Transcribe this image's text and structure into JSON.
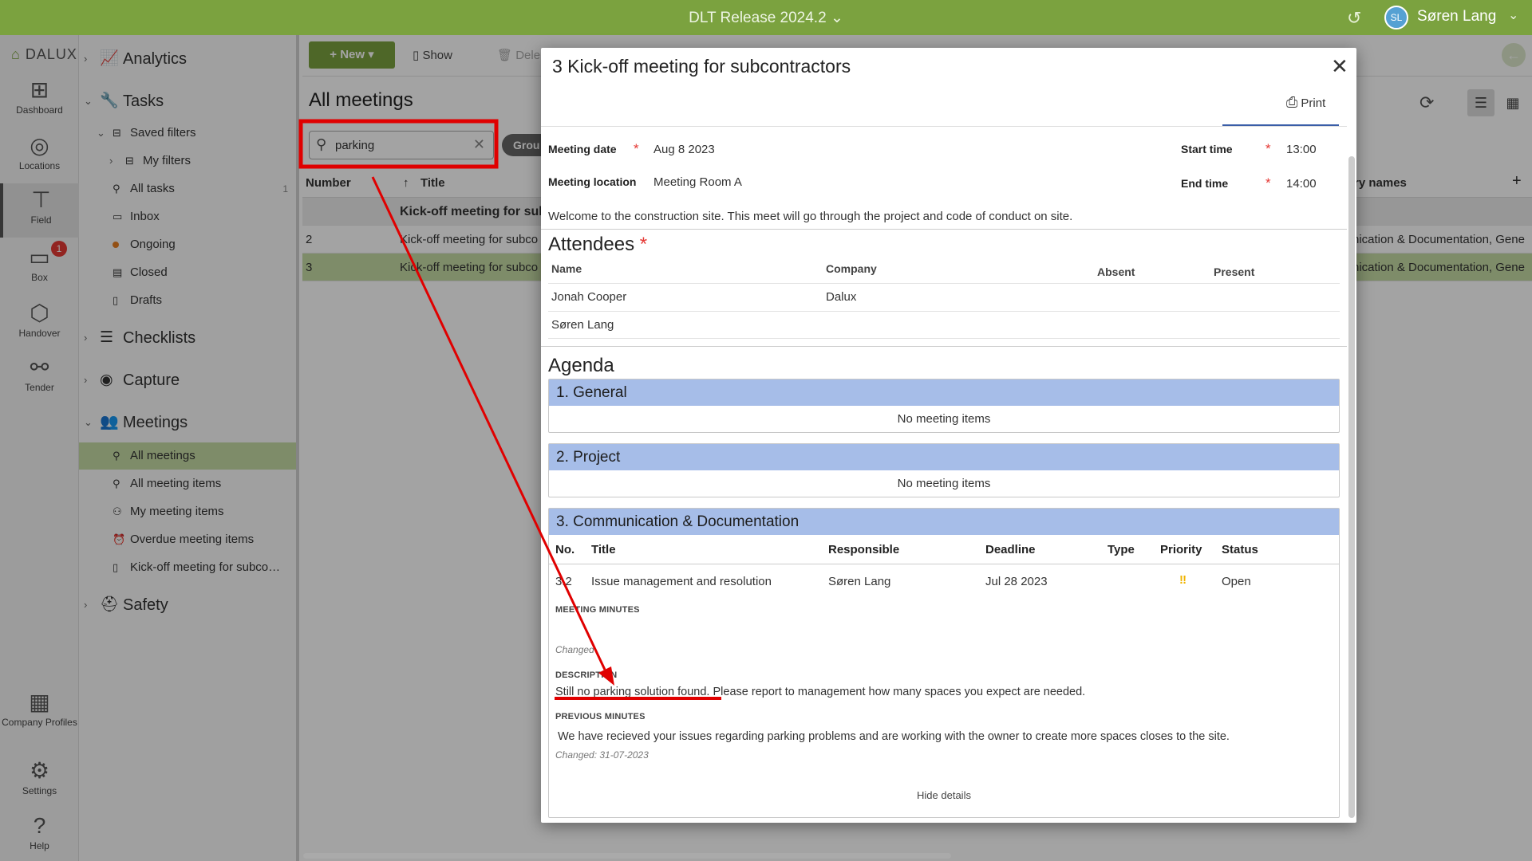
{
  "topbar": {
    "project": "DLT Release 2024.2",
    "user_initials": "SL",
    "user_name": "Søren Lang"
  },
  "rail": {
    "logo": "DALUX",
    "items": [
      {
        "label": "Dashboard",
        "icon": "dashboard-icon"
      },
      {
        "label": "Locations",
        "icon": "location-pin-icon"
      },
      {
        "label": "Field",
        "icon": "crane-icon"
      },
      {
        "label": "Box",
        "icon": "folder-icon",
        "badge": "1"
      },
      {
        "label": "Handover",
        "icon": "box-icon"
      },
      {
        "label": "Tender",
        "icon": "handshake-icon"
      },
      {
        "label": "Company Profiles",
        "icon": "building-icon"
      },
      {
        "label": "Settings",
        "icon": "gear-icon"
      },
      {
        "label": "Help",
        "icon": "help-icon"
      }
    ]
  },
  "nav": {
    "analytics": "Analytics",
    "tasks": "Tasks",
    "saved_filters": "Saved filters",
    "my_filters": "My filters",
    "all_tasks": "All tasks",
    "all_tasks_count": "1",
    "inbox": "Inbox",
    "ongoing": "Ongoing",
    "closed": "Closed",
    "drafts": "Drafts",
    "checklists": "Checklists",
    "capture": "Capture",
    "meetings": "Meetings",
    "all_meetings": "All meetings",
    "all_meeting_items": "All meeting items",
    "my_meeting_items": "My meeting items",
    "overdue_meeting_items": "Overdue meeting items",
    "kickoff_filter": "Kick-off meeting for subco…",
    "safety": "Safety"
  },
  "main": {
    "new_label": "New",
    "show_label": "Show",
    "delete_label": "Dele",
    "title": "All meetings",
    "search_value": "parking",
    "group_chip": "Grou",
    "col_number": "Number",
    "col_title": "Title",
    "col_category": "ry names",
    "group_row": "Kick-off meeting for sul",
    "rows": [
      {
        "number": "2",
        "title": "Kick-off meeting for subco",
        "categories": "nication & Documentation, Gene"
      },
      {
        "number": "3",
        "title": "Kick-off meeting for subco",
        "categories": "nication & Documentation, Gene"
      }
    ]
  },
  "modal": {
    "title": "3 Kick-off meeting for subcontractors",
    "print_label": "Print",
    "meeting_date_label": "Meeting date",
    "meeting_date": "Aug 8 2023",
    "start_time_label": "Start time",
    "start_time": "13:00",
    "location_label": "Meeting location",
    "location": "Meeting Room A",
    "end_time_label": "End time",
    "end_time": "14:00",
    "description": "Welcome to the construction site. This meet will go through the project and code of conduct on site.",
    "attendees_title": "Attendees",
    "att_col_name": "Name",
    "att_col_company": "Company",
    "att_col_absent": "Absent",
    "att_col_present": "Present",
    "attendees": [
      {
        "name": "Jonah Cooper",
        "company": "Dalux"
      },
      {
        "name": "Søren Lang",
        "company": ""
      }
    ],
    "agenda_title": "Agenda",
    "sections": [
      {
        "title": "1. General",
        "empty": "No meeting items"
      },
      {
        "title": "2. Project",
        "empty": "No meeting items"
      },
      {
        "title": "3. Communication & Documentation"
      }
    ],
    "item_cols": {
      "no": "No.",
      "title": "Title",
      "responsible": "Responsible",
      "deadline": "Deadline",
      "type": "Type",
      "priority": "Priority",
      "status": "Status"
    },
    "item": {
      "no": "3.2",
      "title": "Issue management and resolution",
      "responsible": "Søren Lang",
      "deadline": "Jul 28 2023",
      "priority": "‼",
      "status": "Open",
      "minutes_label": "MEETING MINUTES",
      "changed_short": "Changed",
      "description_label": "DESCRIPTION",
      "description_highlight": "Still no parking solution found.",
      "description_rest": " Please report to management how many spaces you expect are needed.",
      "previous_label": "PREVIOUS MINUTES",
      "previous_text": "We have recieved your issues regarding parking problems and are working with the owner to create more spaces closes to the site.",
      "previous_changed": "Changed: 31-07-2023"
    },
    "hide_details": "Hide details"
  }
}
